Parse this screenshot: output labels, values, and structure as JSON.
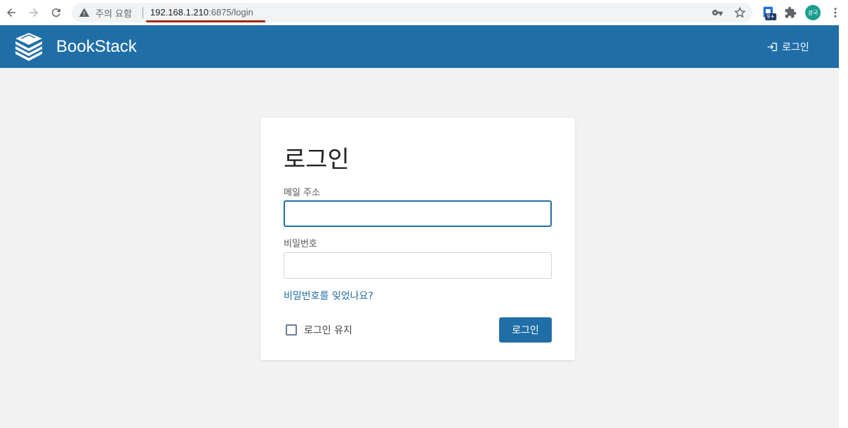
{
  "browser": {
    "security_warning": "주의 요함",
    "url_host": "192.168.1.210",
    "url_path": ":6875/login",
    "extension_badge": "9+",
    "profile_initials": "경국"
  },
  "header": {
    "app_name": "BookStack",
    "login_link": "로그인"
  },
  "login_form": {
    "title": "로그인",
    "email_label": "메일 주소",
    "email_value": "",
    "password_label": "비밀번호",
    "password_value": "",
    "forgot_password": "비밀번호를 잊었나요?",
    "remember_label": "로그인 유지",
    "remember_checked": false,
    "submit_label": "로그인"
  },
  "colors": {
    "brand": "#206ea7",
    "background": "#f2f2f2"
  }
}
